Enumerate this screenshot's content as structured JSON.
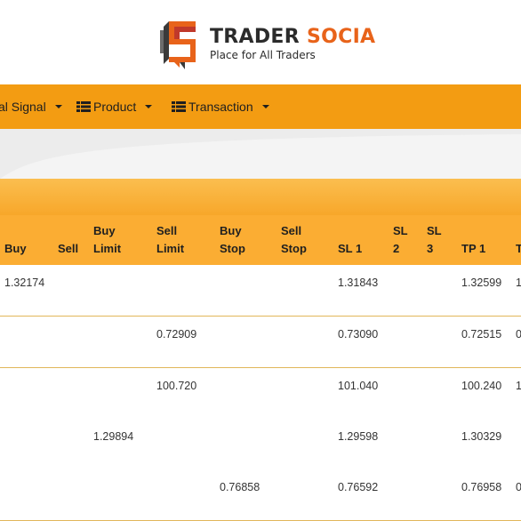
{
  "brand": {
    "name_part1": "TRADER",
    "name_part2": "SOCIA",
    "tagline": "Place for All Traders"
  },
  "colors": {
    "accent": "#f39c12",
    "brand_orange": "#e8631a",
    "header_bg": "#fbad33"
  },
  "navbar": {
    "items": [
      {
        "label": "al Signal",
        "icon": ""
      },
      {
        "label": "Product",
        "icon": "list-icon"
      },
      {
        "label": "Transaction",
        "icon": "list-icon"
      }
    ]
  },
  "table": {
    "headers": {
      "buy": "Buy",
      "sell": "Sell",
      "buy_limit_1": "Buy",
      "buy_limit_2": "Limit",
      "sell_limit_1": "Sell",
      "sell_limit_2": "Limit",
      "buy_stop_1": "Buy",
      "buy_stop_2": "Stop",
      "sell_stop_1": "Sell",
      "sell_stop_2": "Stop",
      "sl1": "SL 1",
      "sl2_1": "SL",
      "sl2_2": "2",
      "sl3_1": "SL",
      "sl3_2": "3",
      "tp1": "TP 1",
      "tp2": "T"
    },
    "rows": [
      {
        "buy": "1.32174",
        "sell": "",
        "buy_limit": "",
        "sell_limit": "",
        "buy_stop": "",
        "sell_stop": "",
        "sl1": "1.31843",
        "tp1": "1.32599",
        "tp2": "1"
      },
      {
        "buy": "",
        "sell": "",
        "buy_limit": "",
        "sell_limit": "0.72909",
        "buy_stop": "",
        "sell_stop": "",
        "sl1": "0.73090",
        "tp1": "0.72515",
        "tp2": "0"
      },
      {
        "buy": "",
        "sell": "",
        "buy_limit": "",
        "sell_limit": "100.720",
        "buy_stop": "",
        "sell_stop": "",
        "sl1": "101.040",
        "tp1": "100.240",
        "tp2": "1"
      },
      {
        "buy": "",
        "sell": "",
        "buy_limit": "1.29894",
        "sell_limit": "",
        "buy_stop": "",
        "sell_stop": "",
        "sl1": "1.29598",
        "tp1": "1.30329",
        "tp2": ""
      },
      {
        "buy": "",
        "sell": "",
        "buy_limit": "",
        "sell_limit": "",
        "buy_stop": "0.76858",
        "sell_stop": "",
        "sl1": "0.76592",
        "tp1": "0.76958",
        "tp2": "0"
      }
    ]
  }
}
